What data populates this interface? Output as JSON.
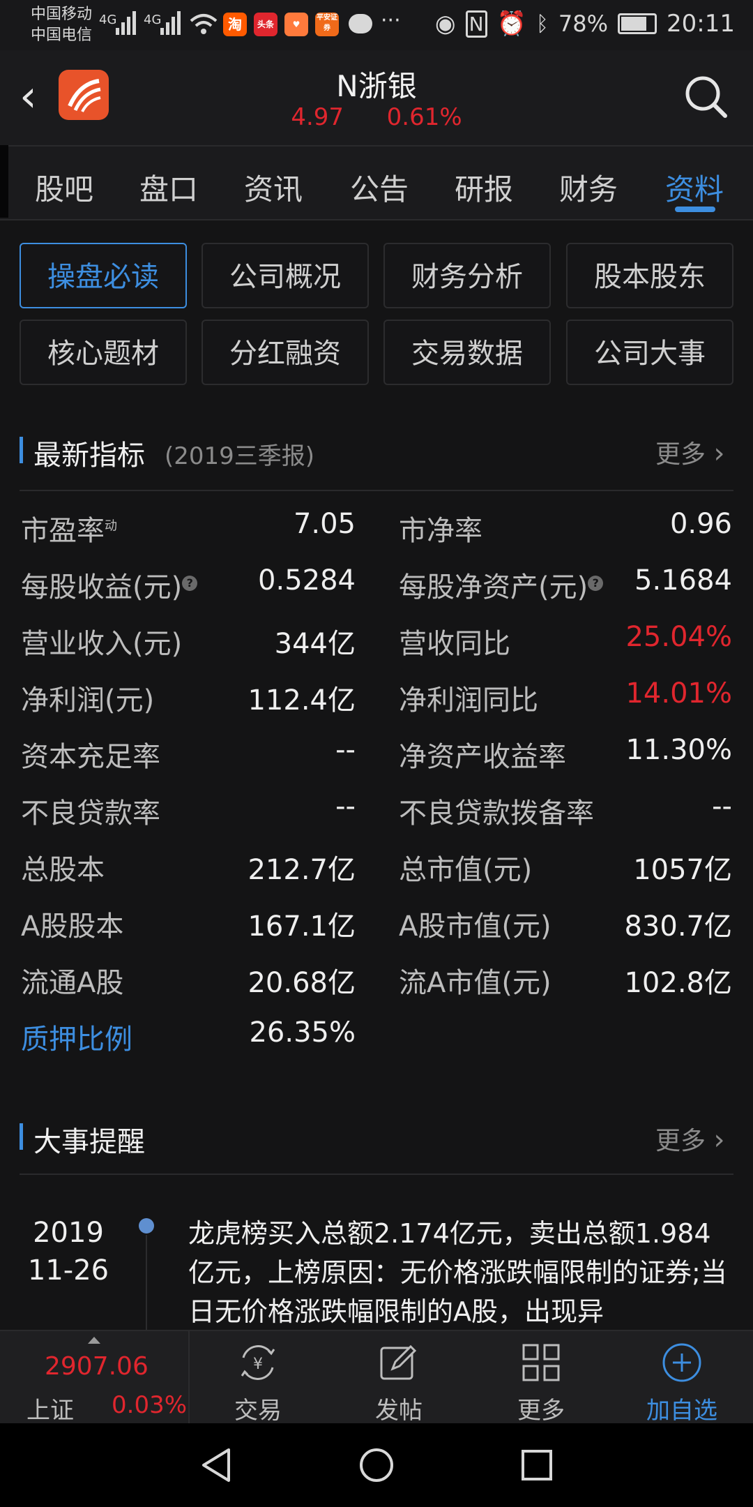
{
  "status_bar": {
    "carrier1": "中国移动",
    "carrier2": "中国电信",
    "net1": "4G",
    "net2": "4G",
    "app1": "淘",
    "app2": "头条",
    "app4": "平安证券",
    "dots": "···",
    "battery": "78%",
    "time": "20:11"
  },
  "header": {
    "stock_name": "N浙银",
    "price": "4.97",
    "change_pct": "0.61%"
  },
  "tabs": [
    "股吧",
    "盘口",
    "资讯",
    "公告",
    "研报",
    "财务",
    "资料"
  ],
  "grid_buttons": [
    "操盘必读",
    "公司概况",
    "财务分析",
    "股本股东",
    "核心题材",
    "分红融资",
    "交易数据",
    "公司大事"
  ],
  "indicators": {
    "title": "最新指标",
    "subtitle": "(2019三季报)",
    "more": "更多",
    "rows": [
      {
        "l_label": "市盈率",
        "l_sup": "动",
        "l_val": "7.05",
        "r_label": "市净率",
        "r_val": "0.96"
      },
      {
        "l_label": "每股收益(元)",
        "l_q": "?",
        "l_val": "0.5284",
        "r_label": "每股净资产(元)",
        "r_q": "?",
        "r_val": "5.1684"
      },
      {
        "l_label": "营业收入(元)",
        "l_val": "344亿",
        "r_label": "营收同比",
        "r_val": "25.04%"
      },
      {
        "l_label": "净利润(元)",
        "l_val": "112.4亿",
        "r_label": "净利润同比",
        "r_val": "14.01%"
      },
      {
        "l_label": "资本充足率",
        "l_val": "--",
        "r_label": "净资产收益率",
        "r_val": "11.30%"
      },
      {
        "l_label": "不良贷款率",
        "l_val": "--",
        "r_label": "不良贷款拨备率",
        "r_val": "--"
      },
      {
        "l_label": "总股本",
        "l_val": "212.7亿",
        "r_label": "总市值(元)",
        "r_val": "1057亿"
      },
      {
        "l_label": "A股股本",
        "l_val": "167.1亿",
        "r_label": "A股市值(元)",
        "r_val": "830.7亿"
      },
      {
        "l_label": "流通A股",
        "l_val": "20.68亿",
        "r_label": "流A市值(元)",
        "r_val": "102.8亿"
      },
      {
        "l_label": "质押比例",
        "l_val": "26.35%"
      }
    ]
  },
  "events": {
    "title": "大事提醒",
    "more": "更多",
    "items": [
      {
        "year": "2019",
        "date": "11-26",
        "text": "龙虎榜买入总额2.174亿元，卖出总额1.984亿元，上榜原因：无价格涨跌幅限制的证券;当日无价格涨跌幅限制的A股，出现异"
      }
    ]
  },
  "bottom_bar": {
    "index_value": "2907.06",
    "index_name": "上证",
    "index_change": "0.03%",
    "trade": "交易",
    "post": "发帖",
    "more": "更多",
    "add_watch": "加自选",
    "yuan_symbol": "¥"
  },
  "colors": {
    "up_red": "#e0262e",
    "accent_blue": "#3d8ee0",
    "bg": "#141415"
  }
}
